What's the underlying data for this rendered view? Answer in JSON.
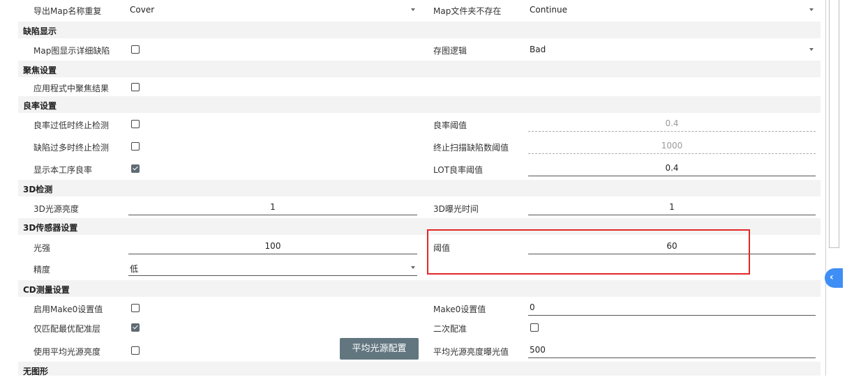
{
  "export": {
    "name_dup_label": "导出Map名称重复",
    "name_dup_value": "Cover",
    "folder_missing_label": "Map文件夹不存在",
    "folder_missing_value": "Continue"
  },
  "defect_display": {
    "title": "缺陷显示",
    "map_detail_label": "Map图显示详细缺陷",
    "map_detail_checked": false,
    "save_logic_label": "存图逻辑",
    "save_logic_value": "Bad"
  },
  "focus": {
    "title": "聚焦设置",
    "apply_focus_label": "应用程式中聚焦结果",
    "apply_focus_checked": false
  },
  "yield": {
    "title": "良率设置",
    "stop_low_label": "良率过低时终止检测",
    "stop_low_checked": false,
    "threshold_label": "良率阈值",
    "threshold_value": "0.4",
    "stop_many_label": "缺陷过多时终止检测",
    "stop_many_checked": false,
    "scan_stop_label": "终止扫描缺陷数阈值",
    "scan_stop_value": "1000",
    "show_yield_label": "显示本工序良率",
    "show_yield_checked": true,
    "lot_threshold_label": "LOT良率阈值",
    "lot_threshold_value": "0.4"
  },
  "detect3d": {
    "title": "3D检测",
    "light_label": "3D光源亮度",
    "light_value": "1",
    "exposure_label": "3D曝光时间",
    "exposure_value": "1"
  },
  "sensor3d": {
    "title": "3D传感器设置",
    "intensity_label": "光强",
    "intensity_value": "100",
    "threshold_label": "阈值",
    "threshold_value": "60",
    "precision_label": "精度",
    "precision_value": "低"
  },
  "cd": {
    "title": "CD测量设置",
    "make0_enable_label": "启用Make0设置值",
    "make0_enable_checked": false,
    "make0_value_label": "Make0设置值",
    "make0_value": "0",
    "best_layer_label": "仅匹配最优配准层",
    "best_layer_checked": true,
    "second_reg_label": "二次配准",
    "second_reg_checked": false,
    "avg_light_label": "使用平均光源亮度",
    "avg_light_checked": false,
    "avg_light_button": "平均光源配置",
    "avg_exposure_label": "平均光源亮度曝光值",
    "avg_exposure_value": "500"
  },
  "no_graphic": {
    "title": "无图形"
  },
  "side_tab": {
    "icon": "chevron-left-icon",
    "glyph": "‹"
  },
  "colors": {
    "accent": "#3e8ef5",
    "highlight": "#e32626",
    "button": "#627680"
  }
}
